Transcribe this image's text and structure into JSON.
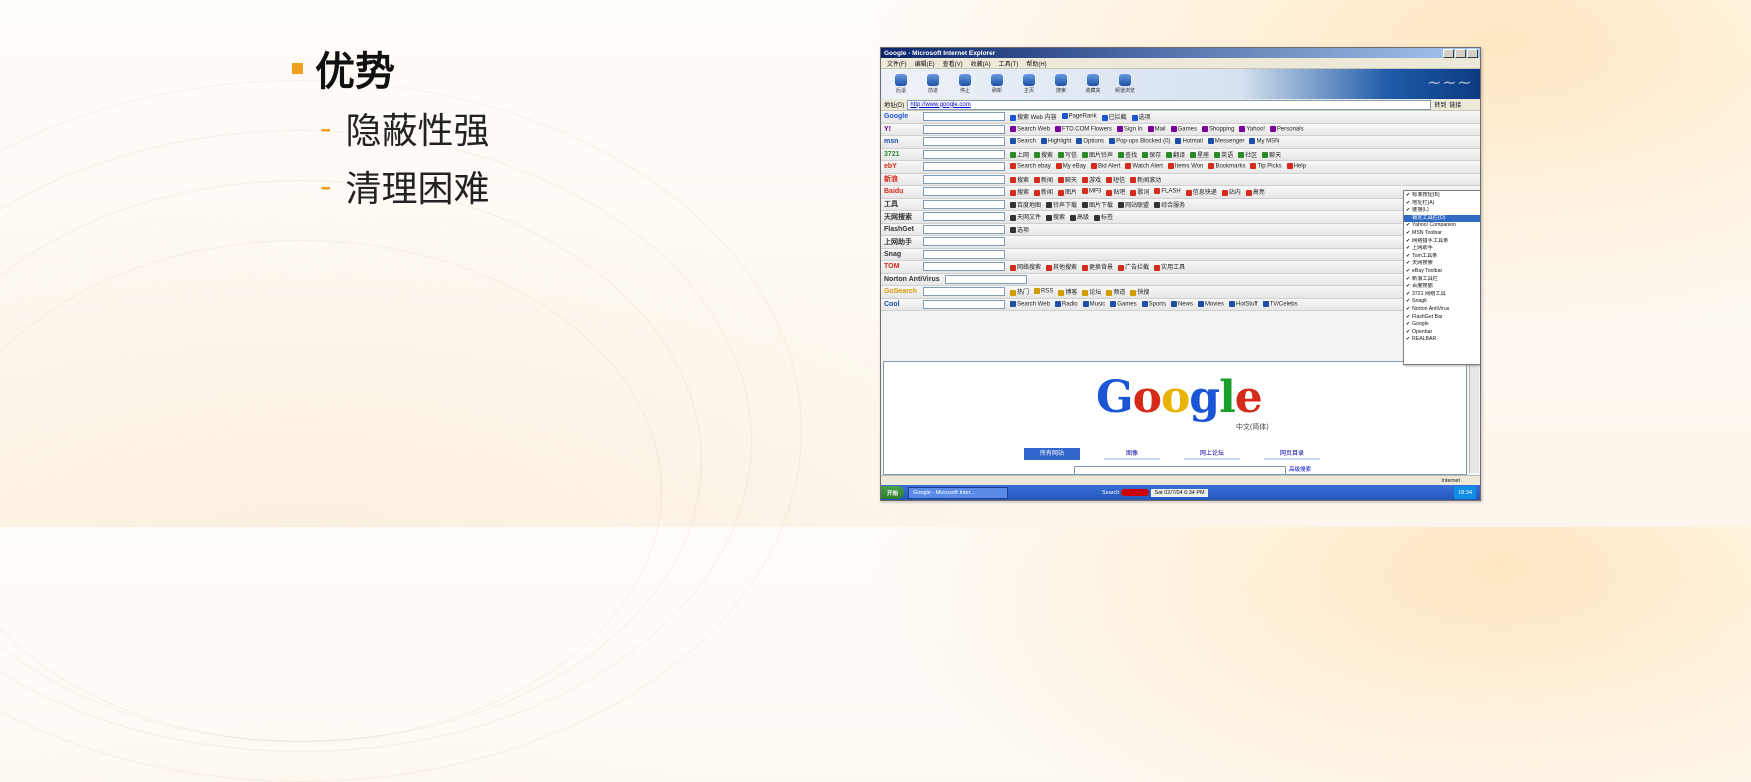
{
  "slide": {
    "heading": "优势",
    "points": [
      "隐蔽性强",
      "清理困难"
    ],
    "accent_color": "#f0a020"
  },
  "browser": {
    "title": "Google - Microsoft Internet Explorer",
    "menu": [
      "文件(F)",
      "编辑(E)",
      "查看(V)",
      "收藏(A)",
      "工具(T)",
      "帮助(H)"
    ],
    "std_buttons": [
      "后退",
      "前进",
      "停止",
      "刷新",
      "主页",
      "搜索",
      "收藏夹",
      "频道浏览"
    ],
    "address_label": "地址(D)",
    "address_value": "http://www.google.com",
    "go_label": "转到",
    "links_label": "链接",
    "toolbars": [
      {
        "brand": "Google",
        "brand_color": "#1a55d6",
        "items": [
          "搜索 Web 内容",
          "PageRank",
          "已拦截",
          "选项"
        ]
      },
      {
        "brand": "Y!",
        "brand_color": "#7b0099",
        "items": [
          "Search Web",
          "FTD.COM Flowers",
          "Sign In",
          "Mail",
          "Games",
          "Shopping",
          "Yahoo!",
          "Personals"
        ]
      },
      {
        "brand": "msn",
        "brand_color": "#1c4fa5",
        "items": [
          "Search",
          "Highlight",
          "Options",
          "Pop-ups Blocked (0)",
          "Hotmail",
          "Messenger",
          "My MSN"
        ]
      },
      {
        "brand": "3721",
        "brand_color": "#2a8a2a",
        "items": [
          "上网",
          "搜索",
          "写信",
          "图片铃声",
          "查找",
          "保存",
          "翻译",
          "星座",
          "英语",
          "社区",
          "聊天"
        ]
      },
      {
        "brand": "ebY",
        "brand_color": "#d62a1a",
        "items": [
          "Search ebay",
          "My eBay",
          "Bid Alert",
          "Watch Alert",
          "Items Won",
          "Bookmarks",
          "Tip Picks",
          "Help"
        ]
      },
      {
        "brand": "新浪",
        "brand_color": "#d62a1a",
        "items": [
          "搜索",
          "新闻",
          "聊天",
          "游戏",
          "短信",
          "新闻滚动"
        ]
      },
      {
        "brand": "Baidu",
        "brand_color": "#d62a1a",
        "items": [
          "搜索",
          "新闻",
          "图片",
          "MP3",
          "贴吧",
          "歌词",
          "FLASH",
          "信息快递",
          "站内",
          "高亮"
        ]
      },
      {
        "brand": "工具",
        "brand_color": "#333333",
        "items": [
          "百度地图",
          "铃声下载",
          "图片下载",
          "网站联盟",
          "综合服务"
        ]
      },
      {
        "brand": "天网搜索",
        "brand_color": "#333333",
        "items": [
          "天网文件",
          "搜索",
          "高级",
          "标签"
        ]
      },
      {
        "brand": "FlashGet",
        "brand_color": "#333333",
        "items": [
          "选项"
        ]
      },
      {
        "brand": "上网助手",
        "brand_color": "#333333",
        "items": []
      },
      {
        "brand": "Snag",
        "brand_color": "#333333",
        "items": []
      },
      {
        "brand": "TOM",
        "brand_color": "#d62a1a",
        "items": [
          "网络搜索",
          "其他搜索",
          "更换背景",
          "广告拦截",
          "实用工具"
        ]
      },
      {
        "brand": "Norton AntiVirus",
        "brand_color": "#333333",
        "items": []
      },
      {
        "brand": "GoSearch",
        "brand_color": "#d69a00",
        "items": [
          "热门",
          "RSS",
          "博客",
          "论坛",
          "频道",
          "快搜"
        ]
      },
      {
        "brand": "Cool",
        "brand_color": "#1c4fa5",
        "items": [
          "Search Web",
          "Radio",
          "Music",
          "Games",
          "Sports",
          "News",
          "Movies",
          "HotStuff",
          "TV/Celebs"
        ]
      }
    ],
    "context_menu": [
      {
        "label": "标准按钮(B)",
        "checked": true
      },
      {
        "label": "地址栏(A)",
        "checked": true
      },
      {
        "label": "链接(L)",
        "checked": true
      },
      {
        "label": "锁定工具栏(O)",
        "checked": false,
        "highlighted": true
      },
      {
        "label": "Yahoo! Companion",
        "checked": true
      },
      {
        "label": "MSN Toolbar",
        "checked": true
      },
      {
        "label": "网络猎手工具条",
        "checked": true
      },
      {
        "label": "上网助手",
        "checked": true
      },
      {
        "label": "Tom工具条",
        "checked": true
      },
      {
        "label": "天网搜索",
        "checked": true
      },
      {
        "label": "eBay Toolbar",
        "checked": true
      },
      {
        "label": "新浪工具栏",
        "checked": true
      },
      {
        "label": "百度搜霸",
        "checked": true
      },
      {
        "label": "3721 网络工具",
        "checked": true
      },
      {
        "label": "Snagit",
        "checked": true
      },
      {
        "label": "Norton AntiVirus",
        "checked": true
      },
      {
        "label": "FlashGet Bar",
        "checked": true
      },
      {
        "label": "Google",
        "checked": true
      },
      {
        "label": "Openbar",
        "checked": true
      },
      {
        "label": "REALBAR",
        "checked": true
      }
    ],
    "google_page": {
      "logo": "Google",
      "subtitle": "中文(简体)",
      "tabs": [
        "所有网站",
        "图像",
        "网上论坛",
        "网页目录"
      ],
      "advanced": "高级搜索"
    },
    "status_zone": "Internet",
    "taskbar": {
      "start": "开始",
      "task": "Google - Microsoft Inter...",
      "search_label": "Search",
      "date": "Sat 02/7/04 6:34 PM",
      "time": "18:34"
    }
  }
}
